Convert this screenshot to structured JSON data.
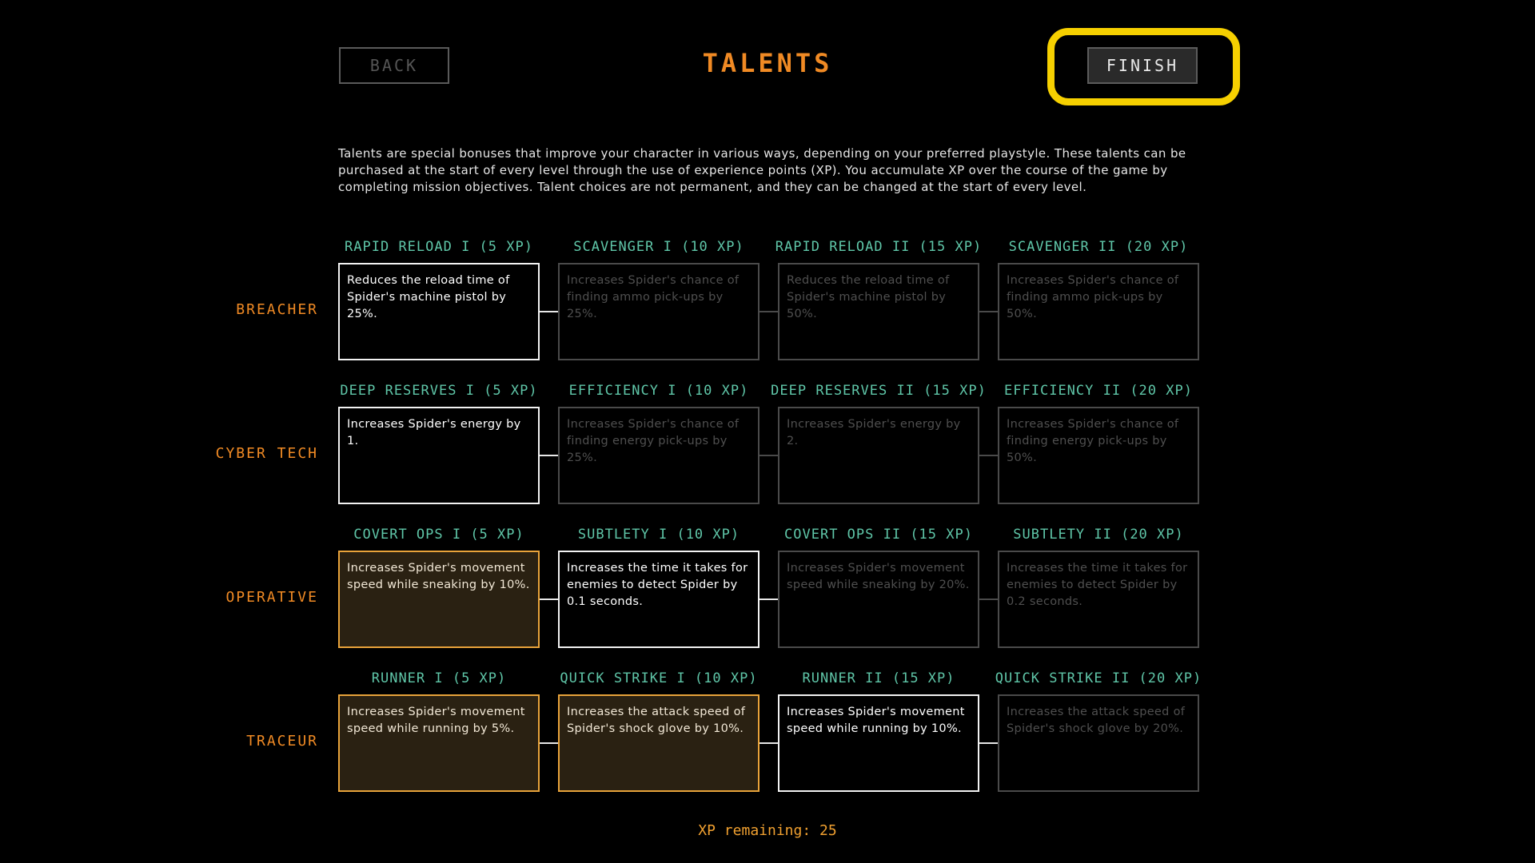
{
  "header": {
    "back_label": "BACK",
    "title": "TALENTS",
    "finish_label": "FINISH"
  },
  "intro": "Talents are special bonuses that improve your character in various ways, depending on your preferred playstyle. These talents can be purchased at the start of every level through the use of experience points (XP). You accumulate XP over the course of the game by completing mission objectives. Talent choices are not permanent, and they can be changed at the start of every level.",
  "rows": [
    {
      "label": "BREACHER",
      "talents": [
        {
          "title": "RAPID RELOAD I (5 XP)",
          "desc": "Reduces the reload time of Spider's machine pistol by 25%.",
          "state": "available"
        },
        {
          "title": "SCAVENGER I (10 XP)",
          "desc": "Increases Spider's chance of finding ammo pick-ups by 25%.",
          "state": "locked"
        },
        {
          "title": "RAPID RELOAD II (15 XP)",
          "desc": "Reduces the reload time of Spider's machine pistol by 50%.",
          "state": "locked"
        },
        {
          "title": "SCAVENGER II (20 XP)",
          "desc": "Increases Spider's chance of finding ammo pick-ups by 50%.",
          "state": "locked"
        }
      ]
    },
    {
      "label": "CYBER TECH",
      "talents": [
        {
          "title": "DEEP RESERVES I (5 XP)",
          "desc": "Increases Spider's energy by 1.",
          "state": "available"
        },
        {
          "title": "EFFICIENCY I (10 XP)",
          "desc": "Increases Spider's chance of finding energy pick-ups by 25%.",
          "state": "locked"
        },
        {
          "title": "DEEP RESERVES II (15 XP)",
          "desc": "Increases Spider's energy by 2.",
          "state": "locked"
        },
        {
          "title": "EFFICIENCY II (20 XP)",
          "desc": "Increases Spider's chance of finding energy pick-ups by 50%.",
          "state": "locked"
        }
      ]
    },
    {
      "label": "OPERATIVE",
      "talents": [
        {
          "title": "COVERT OPS I (5 XP)",
          "desc": "Increases Spider's movement speed while sneaking by 10%.",
          "state": "purchased"
        },
        {
          "title": "SUBTLETY I (10 XP)",
          "desc": "Increases the time it takes for enemies to detect Spider by 0.1 seconds.",
          "state": "available"
        },
        {
          "title": "COVERT OPS II (15 XP)",
          "desc": "Increases Spider's movement speed while sneaking by 20%.",
          "state": "locked"
        },
        {
          "title": "SUBTLETY II (20 XP)",
          "desc": "Increases the time it takes for enemies to detect Spider by 0.2 seconds.",
          "state": "locked"
        }
      ]
    },
    {
      "label": "TRACEUR",
      "talents": [
        {
          "title": "RUNNER I (5 XP)",
          "desc": "Increases Spider's movement speed while running by 5%.",
          "state": "purchased"
        },
        {
          "title": "QUICK STRIKE I (10 XP)",
          "desc": "Increases the attack speed of Spider's shock glove by 10%.",
          "state": "purchased"
        },
        {
          "title": "RUNNER II (15 XP)",
          "desc": "Increases Spider's movement speed while running by 10%.",
          "state": "available"
        },
        {
          "title": "QUICK STRIKE II (20 XP)",
          "desc": "Increases the attack speed of Spider's shock glove by 20%.",
          "state": "locked"
        }
      ]
    }
  ],
  "xp_remaining": "XP remaining: 25",
  "colors": {
    "accent_orange": "#f08a24",
    "talent_title_teal": "#5fc6a8",
    "highlight_yellow": "#f6d000",
    "purchased_fill": "#2a2112"
  }
}
